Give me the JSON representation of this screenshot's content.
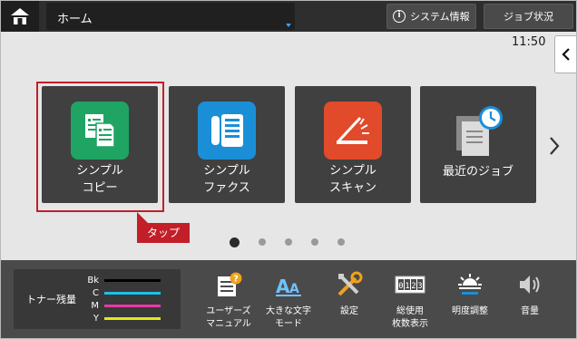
{
  "header": {
    "title": "ホーム",
    "system_info": "システム情報",
    "job_status": "ジョブ状況"
  },
  "clock": "11:50",
  "tiles": [
    {
      "line1": "シンプル",
      "line2": "コピー",
      "icon": "copy-icon",
      "color": "#1fa464"
    },
    {
      "line1": "シンプル",
      "line2": "ファクス",
      "icon": "fax-icon",
      "color": "#1a8fd8"
    },
    {
      "line1": "シンプル",
      "line2": "スキャン",
      "icon": "scan-icon",
      "color": "#e14a2a"
    },
    {
      "line1": "最近のジョブ",
      "line2": "",
      "icon": "recent-jobs-icon",
      "color": "#9e9e9e"
    }
  ],
  "callout": {
    "label": "タップ",
    "color": "#c21f28"
  },
  "pagination": {
    "pages": 5,
    "current": 1
  },
  "toner": {
    "title": "トナー残量",
    "levels": [
      {
        "name": "Bk",
        "color": "#000000"
      },
      {
        "name": "C",
        "color": "#1ec0e8"
      },
      {
        "name": "M",
        "color": "#e83aa6"
      },
      {
        "name": "Y",
        "color": "#e2e81c"
      }
    ]
  },
  "tools": [
    {
      "line1": "ユーザーズ",
      "line2": "マニュアル",
      "icon": "user-manual-icon"
    },
    {
      "line1": "大きな文字",
      "line2": "モード",
      "icon": "large-text-icon"
    },
    {
      "line1": "設定",
      "line2": "",
      "icon": "settings-icon"
    },
    {
      "line1": "総使用",
      "line2": "枚数表示",
      "icon": "counter-icon"
    },
    {
      "line1": "明度調整",
      "line2": "",
      "icon": "brightness-icon"
    },
    {
      "line1": "音量",
      "line2": "",
      "icon": "volume-icon"
    }
  ]
}
